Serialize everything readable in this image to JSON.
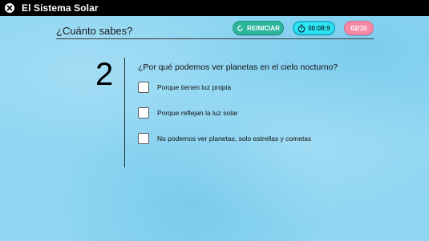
{
  "app": {
    "title": "El Sistema Solar"
  },
  "icons": {
    "close": "close-icon",
    "restart": "restart-icon",
    "timer": "stopwatch-icon"
  },
  "quiz": {
    "heading": "¿Cuánto sabes?",
    "restart_label": "REINICIAR",
    "timer": "00:08:9",
    "counter": "02/10",
    "question_number": "2",
    "question": "¿Por qué podemos ver planetas en el cielo nocturno?",
    "options": [
      {
        "label": "Porque tienen luz propia",
        "checked": false
      },
      {
        "label": "Porque reflejan la luz solar",
        "checked": false
      },
      {
        "label": "No podemos ver planetas, solo estrellas y cometas",
        "checked": false
      }
    ]
  },
  "colors": {
    "background": "#8fd6f2",
    "restart_button": "#2bb59a",
    "timer_pill": "#2ee6f2",
    "counter_pill": "#f58aa6",
    "titlebar": "#000000"
  }
}
